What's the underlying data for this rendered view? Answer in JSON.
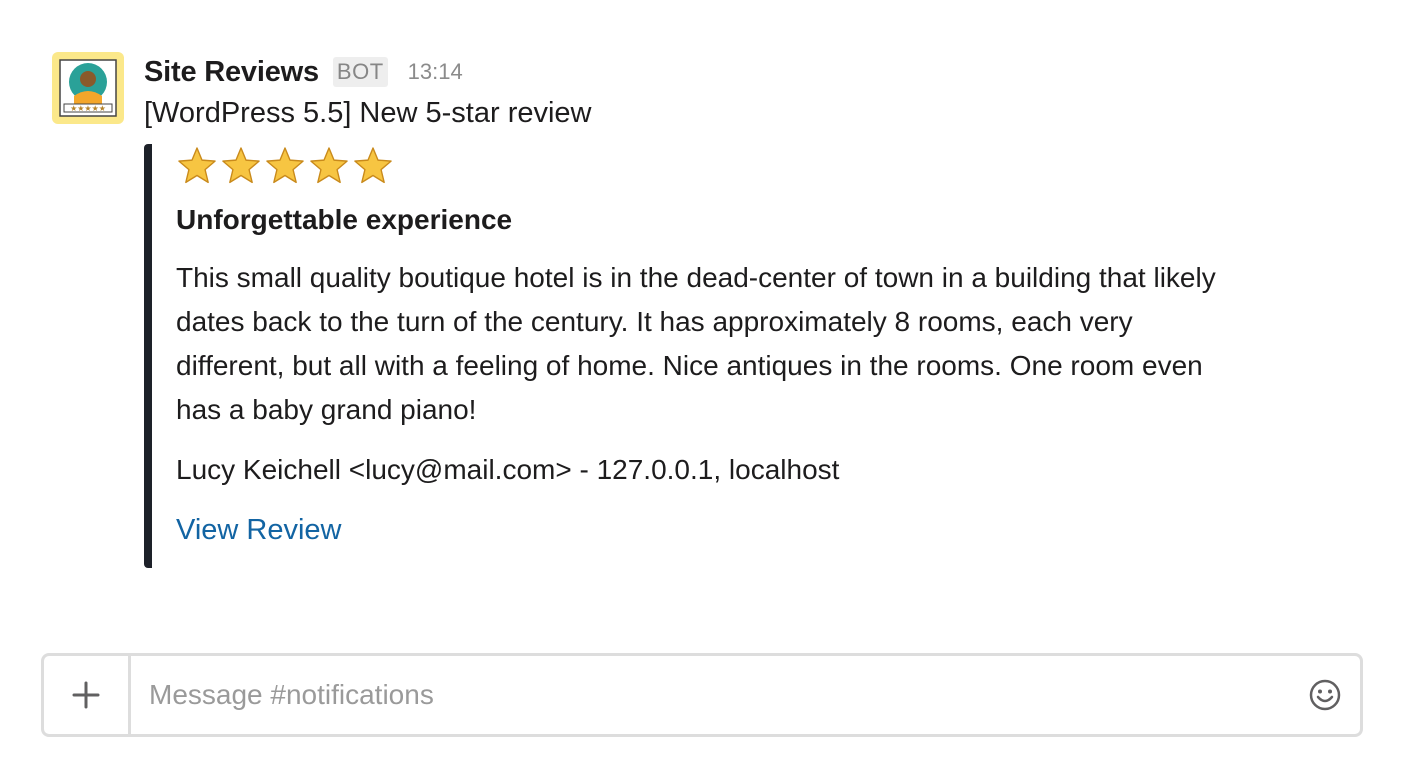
{
  "message": {
    "sender": "Site Reviews",
    "badge": "BOT",
    "time": "13:14",
    "text": "[WordPress 5.5] New 5-star review",
    "avatar_icon": "reviewer-avatar-icon"
  },
  "review": {
    "rating": 5,
    "rating_max": 5,
    "star_icon": "star-icon",
    "title": "Unforgettable experience",
    "content": "This small quality boutique hotel is in the dead-center of town in a building that likely dates back to the turn of the century. It has approximately 8 rooms, each very different, but all with a feeling of home. Nice antiques in the rooms. One room even has a baby grand piano!",
    "author": "Lucy Keichell <lucy@mail.com> - 127.0.0.1, localhost",
    "link_label": "View Review",
    "accent_color": "#1d2129"
  },
  "composer": {
    "placeholder": "Message #notifications",
    "add_icon": "plus-icon",
    "emoji_icon": "emoji-icon"
  },
  "colors": {
    "link": "#1264a3",
    "avatar_bg": "#fbe88a",
    "star": "#f7c542"
  }
}
